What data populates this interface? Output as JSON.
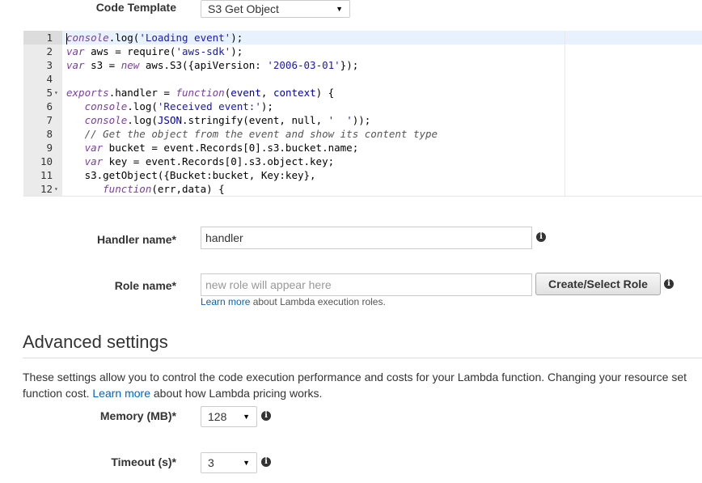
{
  "code_template": {
    "label": "Code Template",
    "selected": "S3 Get Object"
  },
  "editor": {
    "lines": [
      {
        "n": "1",
        "fold": "",
        "html": "<span class=\"cursor\"></span><span class=\"fn\">console</span>.log(<span class=\"str\">'Loading event'</span>);"
      },
      {
        "n": "2",
        "fold": "",
        "html": "<span class=\"kw\">var</span> aws = require(<span class=\"str\">'aws-sdk'</span>);"
      },
      {
        "n": "3",
        "fold": "",
        "html": "<span class=\"kw\">var</span> s3 = <span class=\"kw\">new</span> aws.S3({apiVersion: <span class=\"str\">'2006-03-01'</span>});"
      },
      {
        "n": "4",
        "fold": "",
        "html": ""
      },
      {
        "n": "5",
        "fold": "▾",
        "html": "<span class=\"kw\">exports</span>.handler = <span class=\"kw\">function</span>(<span class=\"prm\">event</span>, <span class=\"prm\">context</span>) {"
      },
      {
        "n": "6",
        "fold": "",
        "html": "   <span class=\"fn\">console</span>.log(<span class=\"str\">'Received event:'</span>);"
      },
      {
        "n": "7",
        "fold": "",
        "html": "   <span class=\"fn\">console</span>.log(<span class=\"prm\">JSON</span>.stringify(event, null, <span class=\"str\">'  '</span>));"
      },
      {
        "n": "8",
        "fold": "",
        "html": "   <span class=\"cm\">// Get the object from the event and show its content type</span>"
      },
      {
        "n": "9",
        "fold": "",
        "html": "   <span class=\"kw\">var</span> bucket = event.Records[0].s3.bucket.name;"
      },
      {
        "n": "10",
        "fold": "",
        "html": "   <span class=\"kw\">var</span> key = event.Records[0].s3.object.key;"
      },
      {
        "n": "11",
        "fold": "",
        "html": "   s3.getObject({Bucket:bucket, Key:key},"
      },
      {
        "n": "12",
        "fold": "▾",
        "html": "      <span class=\"kw\">function</span>(err,data) {"
      }
    ]
  },
  "handler": {
    "label": "Handler name*",
    "value": "handler"
  },
  "role": {
    "label": "Role name*",
    "placeholder": "new role will appear here",
    "button": "Create/Select Role",
    "help_link": "Learn more",
    "help_text": " about Lambda execution roles."
  },
  "advanced": {
    "heading": "Advanced settings",
    "desc_line1": "These settings allow you to control the code execution performance and costs for your Lambda function. Changing your resource set",
    "desc_line2_a": "function cost. ",
    "desc_link": "Learn more",
    "desc_line2_b": " about how Lambda pricing works."
  },
  "memory": {
    "label": "Memory (MB)*",
    "value": "128"
  },
  "timeout": {
    "label": "Timeout (s)*",
    "value": "3"
  }
}
